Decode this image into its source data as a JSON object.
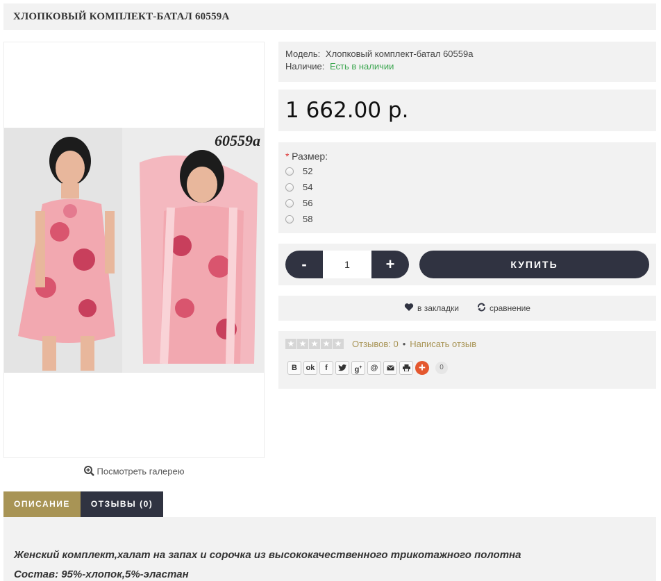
{
  "product": {
    "title": "ХЛОПКОВЫЙ КОМПЛЕКТ-БАТАЛ 60559А",
    "photo_code": "60559а",
    "gallery_link": "Посмотреть галерею"
  },
  "meta": {
    "model_label": "Модель:",
    "model_value": "Хлопковый комплект-батал 60559а",
    "stock_label": "Наличие:",
    "stock_value": "Есть в наличии"
  },
  "price": "1 662.00 р.",
  "options": {
    "required_mark": "*",
    "title": "Размер:",
    "sizes": [
      "52",
      "54",
      "56",
      "58"
    ]
  },
  "cart": {
    "minus": "-",
    "plus": "+",
    "quantity": "1",
    "buy_label": "КУПИТЬ"
  },
  "actions": {
    "wishlist": "в закладки",
    "compare": "сравнение"
  },
  "reviews": {
    "rating_stars": 0,
    "count_label": "Отзывов: 0",
    "separator": "•",
    "write_label": "Написать отзыв",
    "share_count": "0"
  },
  "tabs": [
    {
      "label": "ОПИСАНИЕ"
    },
    {
      "label": "ОТЗЫВЫ (0)"
    }
  ],
  "description": {
    "line1": "Женский комплект,халат на запах и сорочка из высококачественного трикотажного полотна",
    "line2": "Состав: 95%-хлопок,5%-эластан"
  },
  "colors": {
    "accent_gold": "#a89455",
    "dark_navy": "#303341",
    "in_stock_green": "#3aa54e",
    "panel_gray": "#f2f2f2"
  }
}
